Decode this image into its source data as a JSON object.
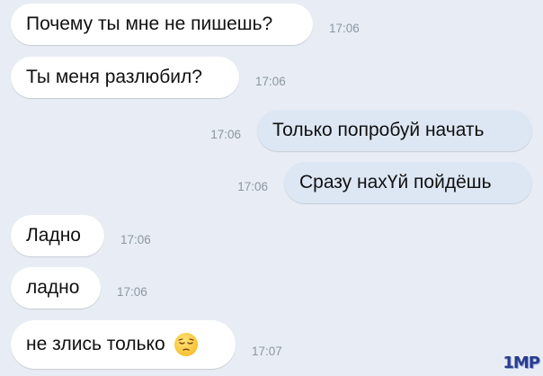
{
  "messages": [
    {
      "text": "Почему ты мне не пишешь?",
      "time": "17:06",
      "direction": "incoming"
    },
    {
      "text": "Ты меня разлюбил?",
      "time": "17:06",
      "direction": "incoming"
    },
    {
      "text": "Только попробуй начать",
      "time": "17:06",
      "direction": "outgoing"
    },
    {
      "text": "Сразу нахҮй пойдёшь",
      "time": "17:06",
      "direction": "outgoing"
    },
    {
      "text": "Ладно",
      "time": "17:06",
      "direction": "incoming"
    },
    {
      "text": "ладно",
      "time": "17:06",
      "direction": "incoming"
    },
    {
      "text": "не злись только",
      "time": "17:07",
      "direction": "incoming",
      "emoji": "pensive-face-icon"
    }
  ],
  "watermark": "1MP",
  "colors": {
    "background": "#e8edf5",
    "incoming_bubble": "#ffffff",
    "outgoing_bubble": "#dde7f4",
    "time_text": "#8c96a2"
  }
}
